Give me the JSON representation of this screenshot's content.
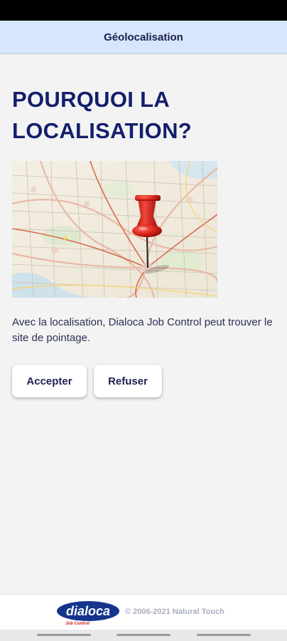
{
  "header": {
    "title": "Géolocalisation"
  },
  "main": {
    "title": "POURQUOI LA LOCALISATION?",
    "description": "Avec la localisation, Dialoca Job Control peut trouver le site de pointage.",
    "buttons": {
      "accept_label": "Accepter",
      "refuse_label": "Refuser"
    },
    "image": {
      "icon": "map-with-red-pin"
    }
  },
  "footer": {
    "logo_text": "dialoca",
    "logo_subtext": "Job Control",
    "copyright": "© 2006-2021 Natural Touch"
  },
  "colors": {
    "header_bg": "#d6e6fc",
    "title": "#131f6b",
    "logo_blue": "#16348e",
    "logo_red": "#d3161d"
  }
}
